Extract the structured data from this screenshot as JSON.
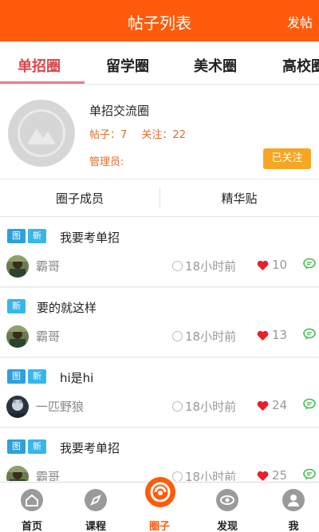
{
  "header": {
    "title": "帖子列表",
    "post_label": "发帖"
  },
  "tabs": [
    {
      "label": "单招圈",
      "active": true
    },
    {
      "label": "留学圈"
    },
    {
      "label": "美术圈"
    },
    {
      "label": "高校圈"
    }
  ],
  "circle": {
    "name": "单招交流圈",
    "posts_label": "帖子：7",
    "follows_label": "关注：22",
    "admin_label": "管理员:",
    "follow_button": "已关注"
  },
  "subtabs": [
    "圈子成员",
    "精华贴"
  ],
  "posts": [
    {
      "badges": [
        "图",
        "新"
      ],
      "title": "我要考单招",
      "user": "霸哥",
      "time": "18小时前",
      "likes": "10"
    },
    {
      "badges": [
        "新"
      ],
      "title": "要的就这样",
      "user": "霸哥",
      "time": "18小时前",
      "likes": "13"
    },
    {
      "badges": [
        "图",
        "新"
      ],
      "title": "hi是hi",
      "user": "一匹野狼",
      "time": "18小时前",
      "likes": "24"
    },
    {
      "badges": [
        "图",
        "新"
      ],
      "title": "我要考单招",
      "user": "霸哥",
      "time": "18小时前",
      "likes": "25"
    }
  ],
  "bottom_nav": [
    {
      "label": "首页",
      "icon": "home-icon"
    },
    {
      "label": "课程",
      "icon": "compass-icon"
    },
    {
      "label": "圈子",
      "icon": "circle-icon",
      "active": true
    },
    {
      "label": "发现",
      "icon": "eye-icon"
    },
    {
      "label": "我",
      "icon": "user-icon"
    }
  ],
  "colors": {
    "brand": "#ff5b0a",
    "active_tab": "#d9464b",
    "follow": "#f6a623",
    "badge": "#2f9fde",
    "like": "#e8202a"
  }
}
